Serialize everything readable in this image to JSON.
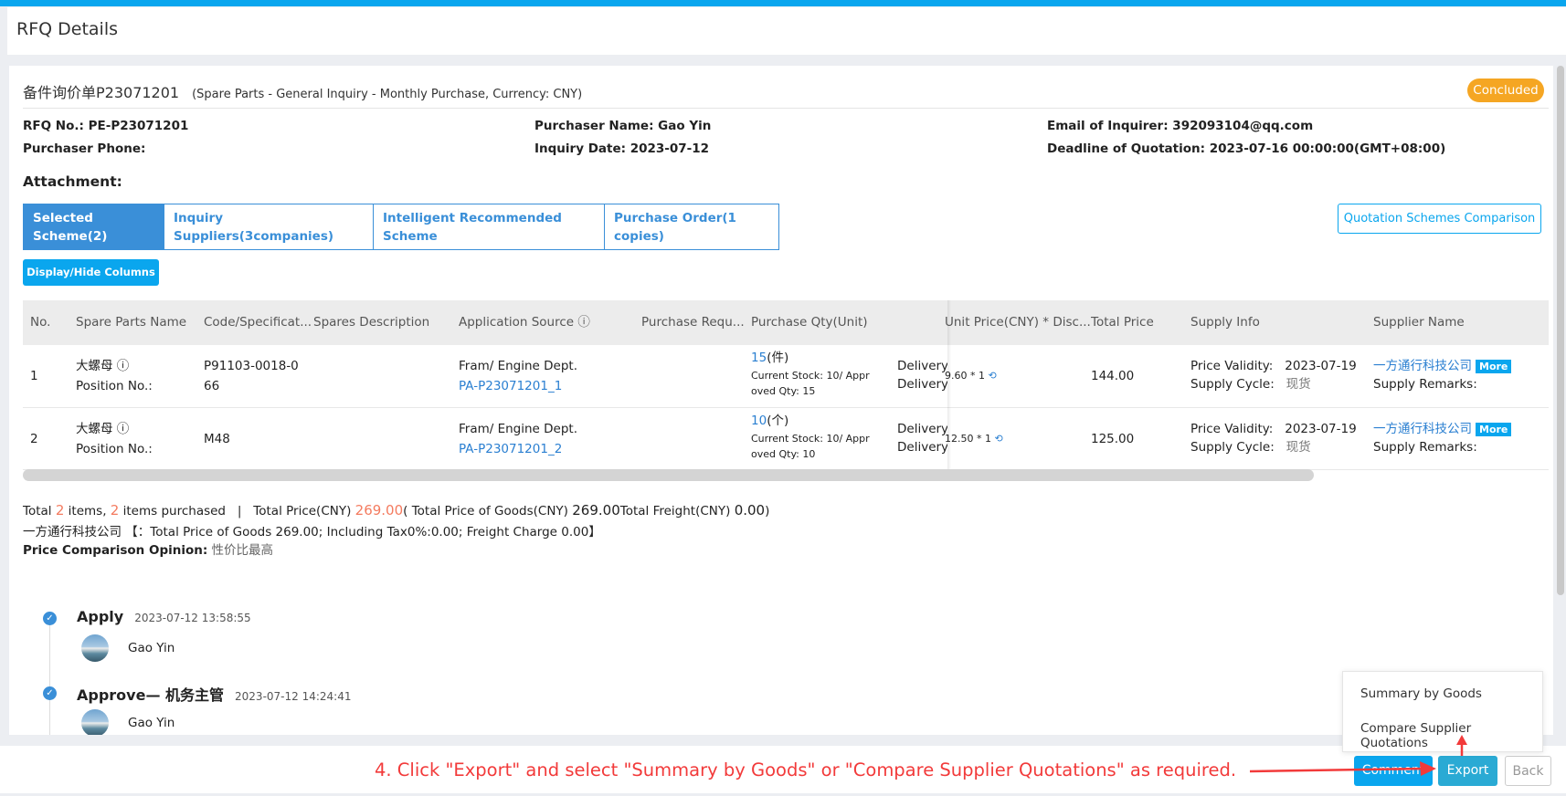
{
  "header": {
    "title": "RFQ Details"
  },
  "rfq": {
    "name": "备件询价单P23071201",
    "subtitle": "(Spare Parts - General Inquiry - Monthly Purchase, Currency: CNY)",
    "status": "Concluded",
    "rfq_no": "RFQ No.: PE-P23071201",
    "purchaser_name": "Purchaser Name: Gao Yin",
    "email": "Email of Inquirer: 392093104@qq.com",
    "phone": "Purchaser Phone:",
    "inquiry_date": "Inquiry Date: 2023-07-12",
    "deadline": "Deadline of Quotation: 2023-07-16 00:00:00(GMT+08:00)",
    "attachment": "Attachment:"
  },
  "tabs": [
    {
      "label": "Selected Scheme(2)"
    },
    {
      "label": "Inquiry Suppliers(3companies)"
    },
    {
      "label": "Intelligent Recommended Scheme"
    },
    {
      "label": "Purchase Order(1 copies)"
    }
  ],
  "buttons": {
    "compare": "Quotation Schemes Comparison",
    "display_hide": "Display/Hide Columns",
    "comment": "Comment",
    "export": "Export",
    "back": "Back",
    "more": "More"
  },
  "table": {
    "columns": [
      "No.",
      "Spare Parts Name",
      "Code/Specificat...",
      "Spares Description",
      "Application Source ⓘ",
      "Purchase Requ...",
      "Purchase Qty(Unit)",
      "Unit Price(CNY) * Disc...",
      "Total Price",
      "Supply Info",
      "Supplier Name"
    ],
    "rows": [
      {
        "no": "1",
        "name": "大螺母 ⓘ",
        "position": "Position No.:",
        "code1": "P91103-0018-0",
        "code2": "66",
        "app_dept": "Fram/ Engine Dept.",
        "app_link": "PA-P23071201_1",
        "qty": "15",
        "unit": "(件)",
        "stock": "Current Stock:  10/ Appr",
        "approved": "oved Qty:  15",
        "delivery1": "Delivery",
        "delivery2": "Delivery",
        "unit_price": "9.60 * 1",
        "total": "144.00",
        "validity_label": "Price Validity:",
        "validity": "2023-07-19",
        "cycle_label": "Supply Cycle:",
        "cycle": "现货",
        "supplier": "一方通行科技公司",
        "remarks": "Supply Remarks:"
      },
      {
        "no": "2",
        "name": "大螺母 ⓘ",
        "position": "Position No.:",
        "code1": "M48",
        "code2": "",
        "app_dept": "Fram/ Engine Dept.",
        "app_link": "PA-P23071201_2",
        "qty": "10",
        "unit": "(个)",
        "stock": "Current Stock:  10/ Appr",
        "approved": "oved Qty:  10",
        "delivery1": "Delivery",
        "delivery2": "Delivery",
        "unit_price": "12.50 * 1",
        "total": "125.00",
        "validity_label": "Price Validity:",
        "validity": "2023-07-19",
        "cycle_label": "Supply Cycle:",
        "cycle": "现货",
        "supplier": "一方通行科技公司",
        "remarks": "Supply Remarks:"
      }
    ]
  },
  "totals": {
    "t1": "Total ",
    "items": "2",
    "t2": " items, ",
    "purchased": "2",
    "t3": " items purchased   |   Total Price(CNY) ",
    "total_price": "269.00",
    "t4": "( Total Price of Goods(CNY) ",
    "goods": "269.00",
    "t5": "Total Freight(CNY) ",
    "freight": "0.00",
    "t6": ")",
    "supplier_line": "一方通行科技公司 【：Total Price of Goods 269.00; Including Tax0%:0.00; Freight Charge 0.00】",
    "opinion_label": "Price Comparison Opinion:",
    "opinion": " 性价比最高"
  },
  "timeline": [
    {
      "title": "Apply",
      "time": "2023-07-12 13:58:55",
      "user": "Gao Yin"
    },
    {
      "title": "Approve— 机务主管",
      "time": "2023-07-12 14:24:41",
      "user": "Gao Yin"
    }
  ],
  "export_menu": [
    "Summary by Goods",
    "Compare Supplier Quotations"
  ],
  "instruction": "4. Click \"Export\" and select \"Summary by Goods\" or \"Compare Supplier Quotations\" as required.",
  "colors": {
    "accent": "#0aa6ee",
    "tab": "#3a8fd8",
    "status": "#f5a623",
    "highlight": "#f47b5f",
    "annotation": "#f23a3a"
  }
}
